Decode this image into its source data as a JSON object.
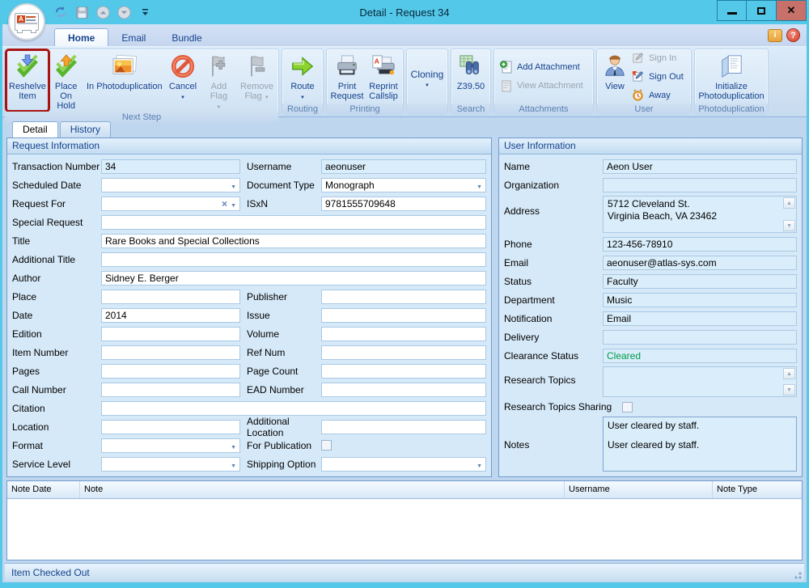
{
  "colors": {
    "frame_cyan": "#54C8E8",
    "close_red": "#C8706A",
    "highlight_red": "#A81412",
    "cleared_green": "#009B48",
    "accent_blue": "#15428B"
  },
  "titlebar": {
    "title": "Detail - Request 34"
  },
  "ribbon_tabs": {
    "home": "Home",
    "email": "Email",
    "bundle": "Bundle"
  },
  "ribbon": {
    "next_step": {
      "caption": "Next Step",
      "reshelve": "Reshelve Item",
      "place_on_hold": "Place On Hold",
      "in_photodup": "In Photoduplication",
      "cancel": "Cancel",
      "add_flag": "Add Flag",
      "remove_flag": "Remove Flag"
    },
    "routing": {
      "caption": "Routing",
      "route": "Route"
    },
    "printing": {
      "caption": "Printing",
      "print_request": "Print Request",
      "reprint_callslip": "Reprint Callslip"
    },
    "cloning": {
      "caption": "",
      "cloning": "Cloning"
    },
    "search": {
      "caption": "Search",
      "z3950": "Z39.50"
    },
    "attachments": {
      "caption": "Attachments",
      "add": "Add Attachment",
      "view": "View Attachment"
    },
    "user": {
      "caption": "User",
      "view": "View",
      "sign_in": "Sign In",
      "sign_out": "Sign Out",
      "away": "Away"
    },
    "photodup": {
      "caption": "Photoduplication",
      "initialize": "Initialize Photoduplication"
    }
  },
  "doc_tabs": {
    "detail": "Detail",
    "history": "History"
  },
  "request_info": {
    "title": "Request Information",
    "transaction_number": {
      "label": "Transaction Number",
      "value": "34"
    },
    "username": {
      "label": "Username",
      "value": "aeonuser"
    },
    "scheduled_date": {
      "label": "Scheduled Date",
      "value": ""
    },
    "document_type": {
      "label": "Document Type",
      "value": "Monograph"
    },
    "request_for": {
      "label": "Request For",
      "value": ""
    },
    "isxn": {
      "label": "ISxN",
      "value": "9781555709648"
    },
    "special_request": {
      "label": "Special Request",
      "value": ""
    },
    "title_field": {
      "label": "Title",
      "value": "Rare Books and Special Collections"
    },
    "additional_title": {
      "label": "Additional Title",
      "value": ""
    },
    "author": {
      "label": "Author",
      "value": "Sidney E. Berger"
    },
    "place": {
      "label": "Place",
      "value": ""
    },
    "publisher": {
      "label": "Publisher",
      "value": ""
    },
    "date": {
      "label": "Date",
      "value": "2014"
    },
    "issue": {
      "label": "Issue",
      "value": ""
    },
    "edition": {
      "label": "Edition",
      "value": ""
    },
    "volume": {
      "label": "Volume",
      "value": ""
    },
    "item_number": {
      "label": "Item Number",
      "value": ""
    },
    "ref_num": {
      "label": "Ref Num",
      "value": ""
    },
    "pages": {
      "label": "Pages",
      "value": ""
    },
    "page_count": {
      "label": "Page Count",
      "value": ""
    },
    "call_number": {
      "label": "Call Number",
      "value": ""
    },
    "ead_number": {
      "label": "EAD Number",
      "value": ""
    },
    "citation": {
      "label": "Citation",
      "value": ""
    },
    "location": {
      "label": "Location",
      "value": ""
    },
    "additional_location": {
      "label": "Additional Location",
      "value": ""
    },
    "format": {
      "label": "Format",
      "value": ""
    },
    "for_publication": {
      "label": "For Publication"
    },
    "service_level": {
      "label": "Service Level",
      "value": ""
    },
    "shipping_option": {
      "label": "Shipping Option",
      "value": ""
    }
  },
  "user_info": {
    "title": "User Information",
    "name": {
      "label": "Name",
      "value": "Aeon User"
    },
    "organization": {
      "label": "Organization",
      "value": ""
    },
    "address": {
      "label": "Address",
      "line1": "5712 Cleveland St.",
      "line2": "Virginia Beach, VA 23462"
    },
    "phone": {
      "label": "Phone",
      "value": "123-456-78910"
    },
    "email": {
      "label": "Email",
      "value": "aeonuser@atlas-sys.com"
    },
    "status": {
      "label": "Status",
      "value": "Faculty"
    },
    "department": {
      "label": "Department",
      "value": "Music"
    },
    "notification": {
      "label": "Notification",
      "value": "Email"
    },
    "delivery": {
      "label": "Delivery",
      "value": ""
    },
    "clearance_status": {
      "label": "Clearance Status",
      "value": "Cleared"
    },
    "research_topics": {
      "label": "Research Topics",
      "value": ""
    },
    "research_topics_sharing": {
      "label": "Research Topics Sharing"
    },
    "notes": {
      "label": "Notes",
      "line1": "User cleared by staff.",
      "line2": "User cleared by staff."
    }
  },
  "notes_table": {
    "columns": [
      "Note Date",
      "Note",
      "Username",
      "Note Type"
    ]
  },
  "status_bar": {
    "text": "Item Checked Out"
  }
}
